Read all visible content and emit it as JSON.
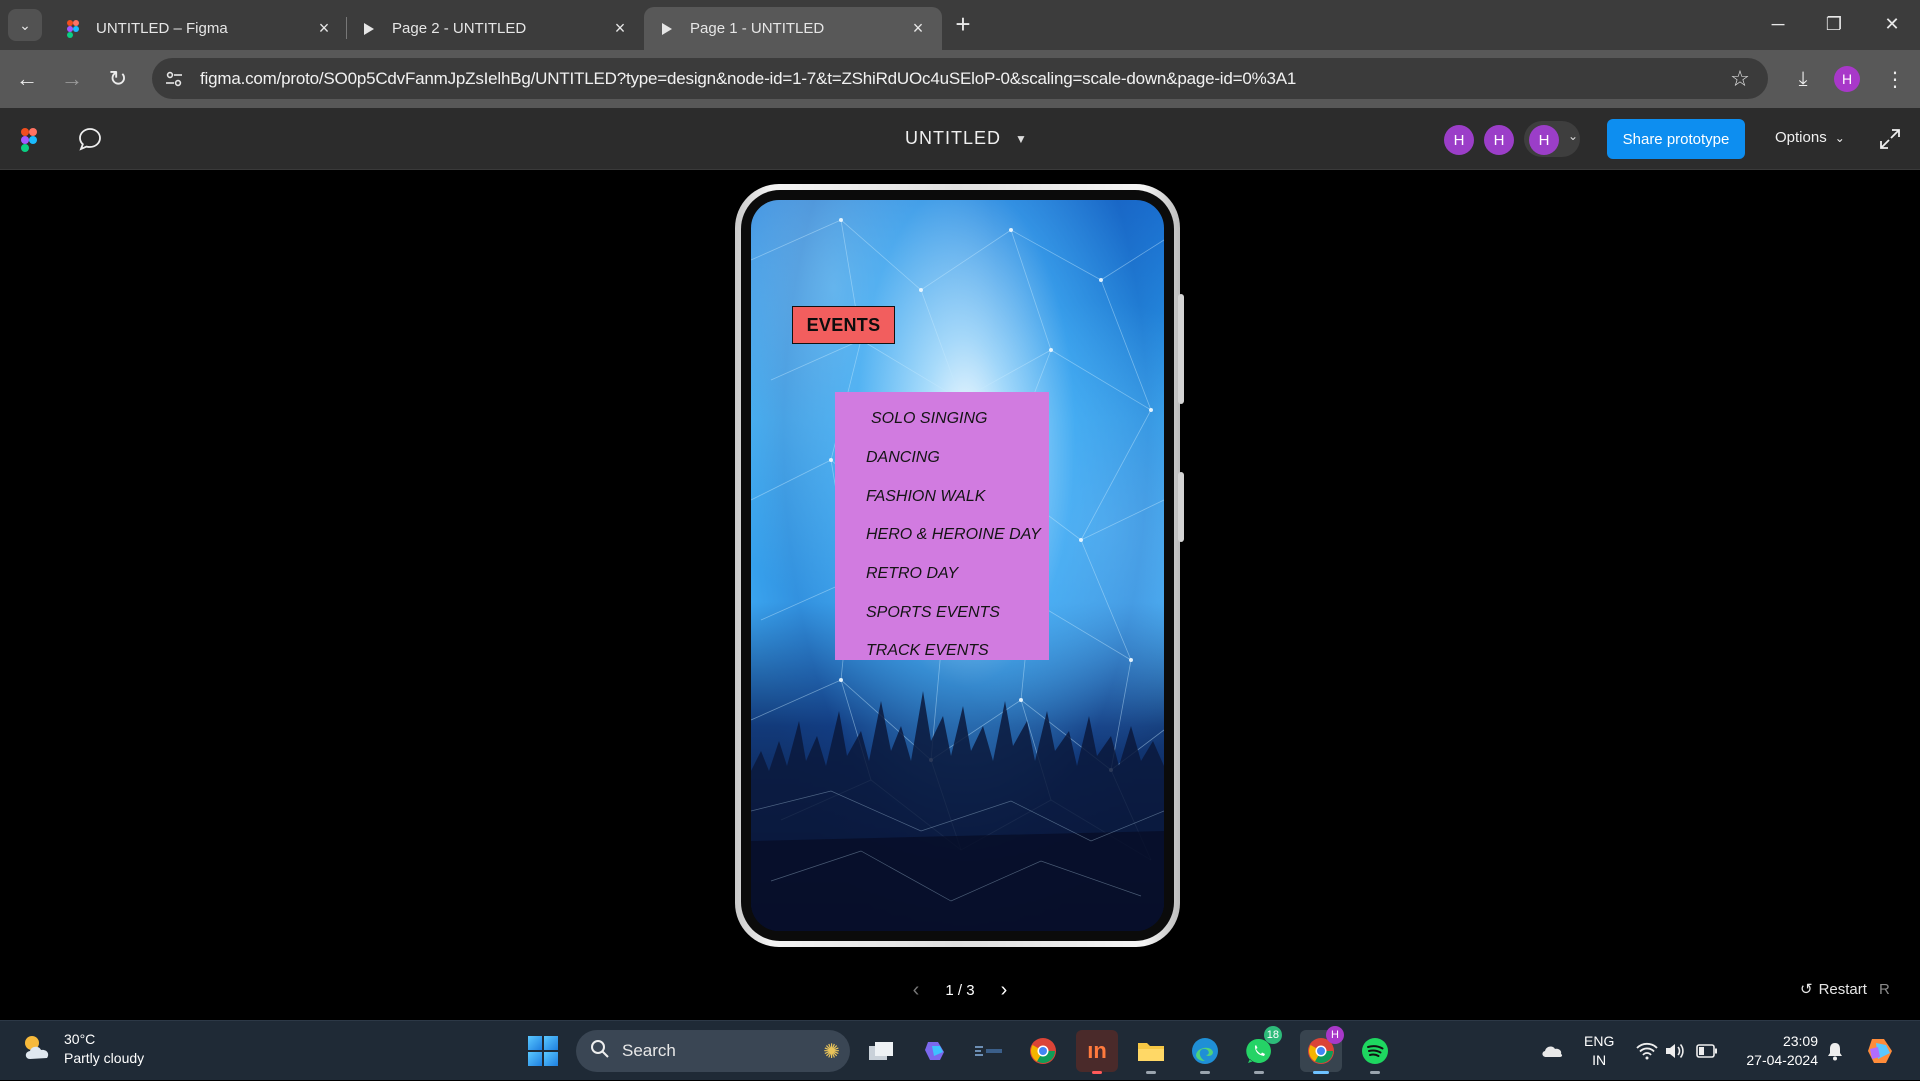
{
  "browser": {
    "tabs": [
      {
        "title": "UNTITLED – Figma",
        "icon": "figma-icon"
      },
      {
        "title": "Page 2 - UNTITLED",
        "icon": "play-icon"
      },
      {
        "title": "Page 1 - UNTITLED",
        "icon": "play-icon",
        "active": true
      }
    ],
    "url": "figma.com/proto/SO0p5CdvFanmJpZsIelhBg/UNTITLED?type=design&node-id=1-7&t=ZShiRdUOc4uSEloP-0&scaling=scale-down&page-id=0%3A1",
    "profile_initial": "H"
  },
  "figma": {
    "file_title": "UNTITLED",
    "avatars": [
      "H",
      "H",
      "H"
    ],
    "share_label": "Share prototype",
    "options_label": "Options"
  },
  "prototype": {
    "events_title": "EVENTS",
    "events": [
      "SOLO SINGING",
      "DANCING",
      "FASHION WALK",
      "HERO & HEROINE DAY",
      "RETRO DAY",
      "SPORTS EVENTS",
      "TRACK EVENTS"
    ],
    "colors": {
      "events_badge": "#f25e5e",
      "events_menu": "#d17be0"
    }
  },
  "viewer": {
    "pager": "1 / 3",
    "restart_label": "Restart",
    "restart_key": "R"
  },
  "taskbar": {
    "temperature": "30°C",
    "weather": "Partly cloudy",
    "search_label": "Search",
    "whatsapp_badge": "18",
    "chrome_badge": "H",
    "lang_top": "ENG",
    "lang_bottom": "IN",
    "time": "23:09",
    "date": "27-04-2024"
  }
}
